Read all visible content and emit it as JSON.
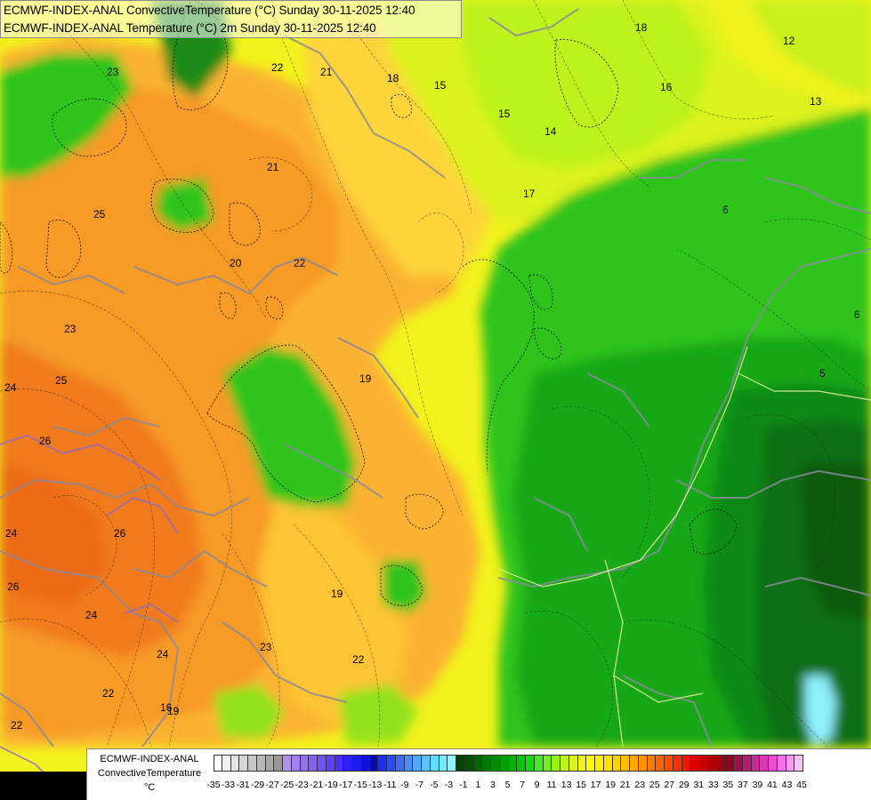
{
  "header": {
    "line1": "ECMWF-INDEX-ANAL ConvectiveTemperature (°C) Sunday 30-11-2025 12:40",
    "line2": "ECMWF-INDEX-ANAL Temperature (°C) 2m Sunday 30-11-2025 12:40"
  },
  "legend": {
    "title_model": "ECMWF-INDEX-ANAL",
    "title_param": "ConvectiveTemperature",
    "title_unit": "°C",
    "ticks": [
      "-35",
      "-33",
      "-31",
      "-29",
      "-27",
      "-25",
      "-23",
      "-21",
      "-19",
      "-17",
      "-15",
      "-13",
      "-11",
      "-9",
      "-7",
      "-5",
      "-3",
      "-1",
      "1",
      "3",
      "5",
      "7",
      "9",
      "11",
      "13",
      "15",
      "17",
      "19",
      "21",
      "23",
      "25",
      "27",
      "29",
      "31",
      "33",
      "35",
      "37",
      "39",
      "41",
      "43",
      "45"
    ],
    "colors": [
      "#ffffff",
      "#f2f2f2",
      "#e4e4e4",
      "#d6d6d6",
      "#c8c8c8",
      "#b8b8b8",
      "#a8a8a8",
      "#989898",
      "#b294e6",
      "#a380ee",
      "#9470f2",
      "#8460f6",
      "#7450fa",
      "#6040ff",
      "#4a30ff",
      "#3020ff",
      "#1c1cf0",
      "#1010d8",
      "#0a0ab4",
      "#1a2cff",
      "#2a4cff",
      "#3a6cff",
      "#4a8cff",
      "#50a8ff",
      "#58c4ff",
      "#60dcff",
      "#74ecff",
      "#8cf6ff",
      "#004400",
      "#005400",
      "#006600",
      "#007a00",
      "#008c00",
      "#00a000",
      "#00b400",
      "#00c800",
      "#10dc10",
      "#40ee20",
      "#70f020",
      "#98f218",
      "#bef21a",
      "#dcf21c",
      "#f0f21e",
      "#ffff00",
      "#fff000",
      "#ffe000",
      "#ffd000",
      "#ffbe00",
      "#ffa800",
      "#ff9200",
      "#ff7c00",
      "#ff6400",
      "#ff4c00",
      "#ff3000",
      "#f01800",
      "#e00000",
      "#c80000",
      "#b00000",
      "#a00010",
      "#960020",
      "#a0104a",
      "#b41c70",
      "#c82a92",
      "#dc38b4",
      "#ee4cd4",
      "#f870ec",
      "#ff96f8",
      "#ffc0fc"
    ]
  },
  "map": {
    "contour_labels": [
      "22",
      "21",
      "18",
      "15",
      "16",
      "18",
      "14",
      "23",
      "21",
      "25",
      "20",
      "22",
      "24",
      "23",
      "25",
      "26",
      "24",
      "26",
      "26",
      "24",
      "24",
      "23",
      "22",
      "22",
      "19",
      "19",
      "17",
      "15",
      "16",
      "6",
      "6",
      "5",
      "19",
      "22",
      "12",
      "13"
    ],
    "colors": {
      "orange_dark": "#f07a1a",
      "orange": "#f79a28",
      "orange_light": "#fbb232",
      "yellow_orange": "#fdd53a",
      "yellow": "#f2f21c",
      "yellow_green": "#c8f01c",
      "light_green": "#92e21a",
      "green": "#2fc41a",
      "dark_green": "#168a16",
      "deep_green": "#0d6f12",
      "cyan": "#8ff0ff"
    }
  }
}
